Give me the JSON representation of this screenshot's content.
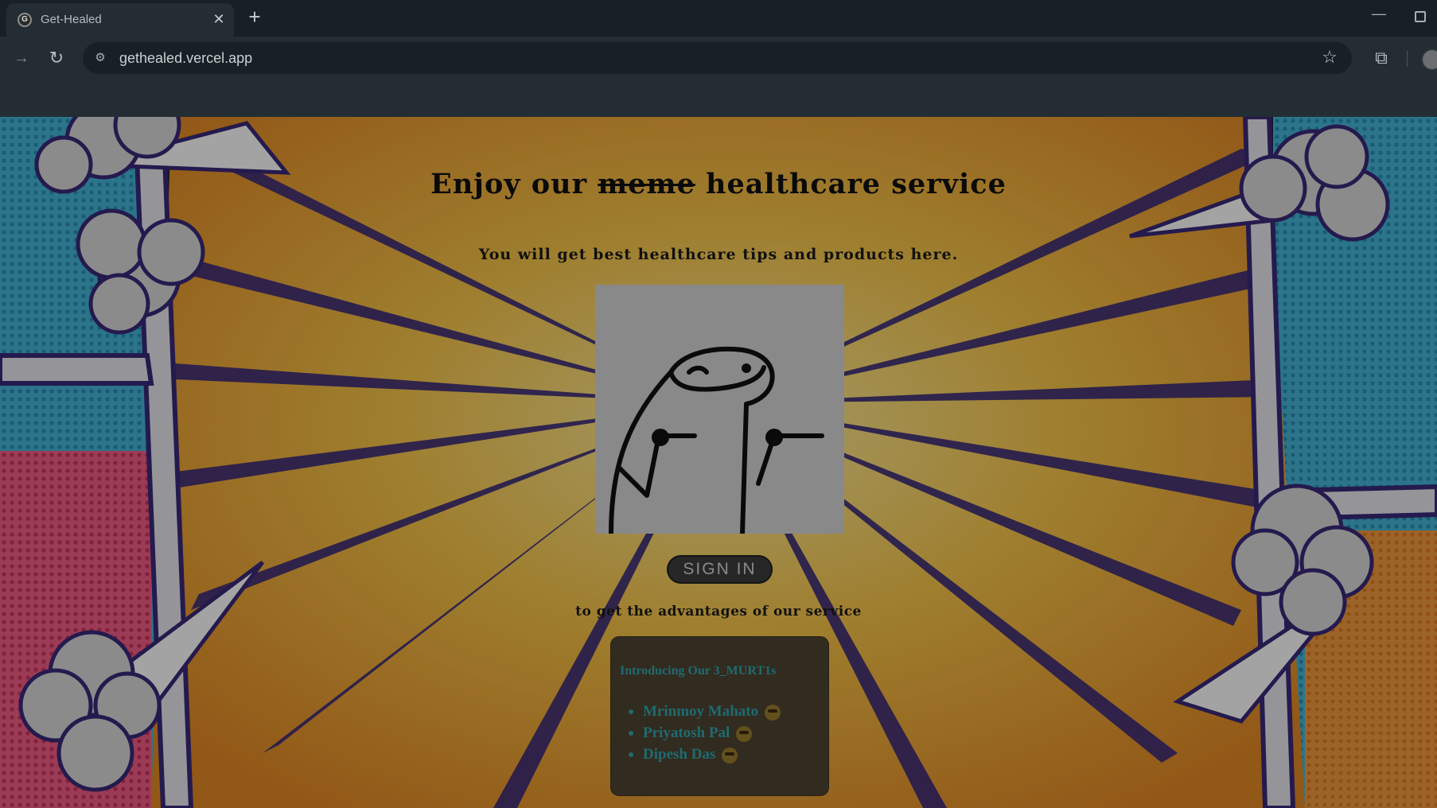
{
  "browser": {
    "tab_title": "Get-Healed",
    "tab_close": "✕",
    "new_tab": "+",
    "url": "gethealed.vercel.app"
  },
  "hero": {
    "headline_before": "Enjoy our ",
    "headline_struck": "meme",
    "headline_after": " healthcare service",
    "tagline": "You will get best healthcare tips and products here."
  },
  "signin": {
    "button_label": "SIGN IN",
    "subtext": "to get the advantages of our service"
  },
  "team": {
    "heading": "Introducing Our 3_MURT1s",
    "members": [
      {
        "name": "Mrinmoy Mahato",
        "emoji": "sunglasses-face"
      },
      {
        "name": "Priyatosh Pal",
        "emoji": "grinning-face"
      },
      {
        "name": "Dipesh Das",
        "emoji": "smiling-face"
      }
    ]
  },
  "icons": {
    "forward": "forward-arrow-icon",
    "reload": "reload-icon",
    "site_info": "site-info-icon",
    "bookmark": "star-icon",
    "extensions": "puzzle-icon",
    "profile": "avatar"
  }
}
